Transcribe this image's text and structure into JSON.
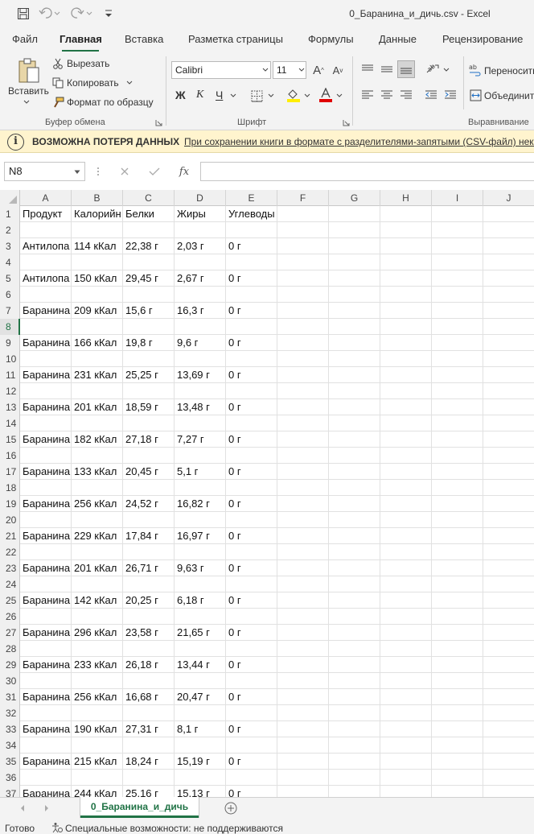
{
  "window": {
    "title": "0_Баранина_и_дичь.csv  -  Excel"
  },
  "menu": {
    "tabs": [
      "Файл",
      "Главная",
      "Вставка",
      "Разметка страницы",
      "Формулы",
      "Данные",
      "Рецензирование"
    ],
    "active_tab": "Главная"
  },
  "ribbon": {
    "clipboard": {
      "paste_label": "Вставить",
      "cut_label": "Вырезать",
      "copy_label": "Копировать",
      "format_painter_label": "Формат по образцу",
      "group_label": "Буфер обмена"
    },
    "font": {
      "font_name": "Calibri",
      "font_size": "11",
      "bold": "Ж",
      "italic": "К",
      "underline": "Ч",
      "group_label": "Шрифт"
    },
    "alignment": {
      "wrap_label": "Переносить",
      "merge_label": "Объединить",
      "group_label": "Выравнивание"
    }
  },
  "infobar": {
    "title": "ВОЗМОЖНА ПОТЕРЯ ДАННЫХ",
    "message": "При сохранении книги в формате с разделителями-запятыми (CSV-файл) неко"
  },
  "formula_bar": {
    "name_box": "N8",
    "fx": "fx",
    "value": ""
  },
  "columns": [
    "A",
    "B",
    "C",
    "D",
    "E",
    "F",
    "G",
    "H",
    "I",
    "J"
  ],
  "rows": [
    {
      "n": "1",
      "cells": [
        "Продукт",
        "Калорийн",
        "Белки",
        "Жиры",
        "Углеводы"
      ]
    },
    {
      "n": "2",
      "cells": []
    },
    {
      "n": "3",
      "cells": [
        "Антилопа",
        "114 кКал",
        "22,38 г",
        "2,03 г",
        "0 г"
      ]
    },
    {
      "n": "4",
      "cells": []
    },
    {
      "n": "5",
      "cells": [
        "Антилопа",
        "150 кКал",
        "29,45 г",
        "2,67 г",
        "0 г"
      ]
    },
    {
      "n": "6",
      "cells": []
    },
    {
      "n": "7",
      "cells": [
        "Баранина",
        "209 кКал",
        "15,6 г",
        "16,3 г",
        "0 г"
      ]
    },
    {
      "n": "8",
      "cells": []
    },
    {
      "n": "9",
      "cells": [
        "Баранина",
        "166 кКал",
        "19,8 г",
        "9,6 г",
        "0 г"
      ]
    },
    {
      "n": "10",
      "cells": []
    },
    {
      "n": "11",
      "cells": [
        "Баранина",
        "231 кКал",
        "25,25 г",
        "13,69 г",
        "0 г"
      ]
    },
    {
      "n": "12",
      "cells": []
    },
    {
      "n": "13",
      "cells": [
        "Баранина",
        "201 кКал",
        "18,59 г",
        "13,48 г",
        "0 г"
      ]
    },
    {
      "n": "14",
      "cells": []
    },
    {
      "n": "15",
      "cells": [
        "Баранина",
        "182 кКал",
        "27,18 г",
        "7,27 г",
        "0 г"
      ]
    },
    {
      "n": "16",
      "cells": []
    },
    {
      "n": "17",
      "cells": [
        "Баранина",
        "133 кКал",
        "20,45 г",
        "5,1 г",
        "0 г"
      ]
    },
    {
      "n": "18",
      "cells": []
    },
    {
      "n": "19",
      "cells": [
        "Баранина",
        "256 кКал",
        "24,52 г",
        "16,82 г",
        "0 г"
      ]
    },
    {
      "n": "20",
      "cells": []
    },
    {
      "n": "21",
      "cells": [
        "Баранина",
        "229 кКал",
        "17,84 г",
        "16,97 г",
        "0 г"
      ]
    },
    {
      "n": "22",
      "cells": []
    },
    {
      "n": "23",
      "cells": [
        "Баранина",
        "201 кКал",
        "26,71 г",
        "9,63 г",
        "0 г"
      ]
    },
    {
      "n": "24",
      "cells": []
    },
    {
      "n": "25",
      "cells": [
        "Баранина",
        "142 кКал",
        "20,25 г",
        "6,18 г",
        "0 г"
      ]
    },
    {
      "n": "26",
      "cells": []
    },
    {
      "n": "27",
      "cells": [
        "Баранина",
        "296 кКал",
        "23,58 г",
        "21,65 г",
        "0 г"
      ]
    },
    {
      "n": "28",
      "cells": []
    },
    {
      "n": "29",
      "cells": [
        "Баранина",
        "233 кКал",
        "26,18 г",
        "13,44 г",
        "0 г"
      ]
    },
    {
      "n": "30",
      "cells": []
    },
    {
      "n": "31",
      "cells": [
        "Баранина",
        "256 кКал",
        "16,68 г",
        "20,47 г",
        "0 г"
      ]
    },
    {
      "n": "32",
      "cells": []
    },
    {
      "n": "33",
      "cells": [
        "Баранина",
        "190 кКал",
        "27,31 г",
        "8,1 г",
        "0 г"
      ]
    },
    {
      "n": "34",
      "cells": []
    },
    {
      "n": "35",
      "cells": [
        "Баранина",
        "215 кКал",
        "18,24 г",
        "15,19 г",
        "0 г"
      ]
    },
    {
      "n": "36",
      "cells": []
    },
    {
      "n": "37",
      "cells": [
        "Баранина",
        "244 кКал",
        "25,16 г",
        "15,13 г",
        "0 г"
      ]
    }
  ],
  "active_row": "8",
  "sheet_tab": "0_Баранина_и_дичь",
  "status": {
    "ready": "Готово",
    "accessibility": "Специальные возможности: не поддерживаются"
  },
  "colors": {
    "accent": "#217346",
    "infobar": "#fff4ce"
  }
}
